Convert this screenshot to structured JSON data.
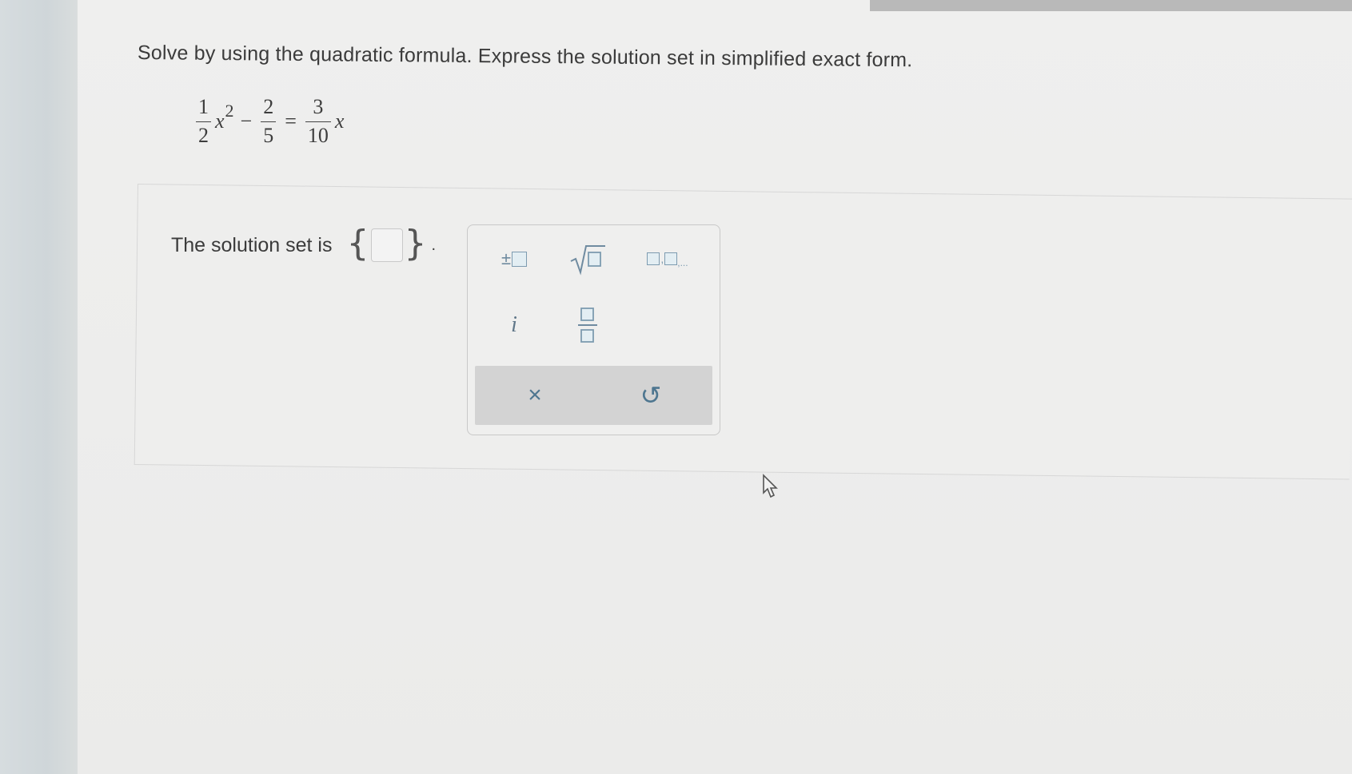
{
  "question": {
    "text": "Solve by using the quadratic formula. Express the solution set in simplified exact form."
  },
  "equation": {
    "term1_num": "1",
    "term1_den": "2",
    "var1": "x",
    "exp": "2",
    "minus": "−",
    "term2_num": "2",
    "term2_den": "5",
    "equals": "=",
    "term3_num": "3",
    "term3_den": "10",
    "var2": "x"
  },
  "answer": {
    "label": "The solution set is",
    "brace_open": "{",
    "brace_close": "}",
    "period": ".",
    "input_value": ""
  },
  "palette": {
    "plus_minus_symbol": "±",
    "list_ellipsis": ",...",
    "imaginary_unit": "i",
    "clear_symbol": "×",
    "undo_symbol": "↺"
  },
  "colors": {
    "accent": "#4e7690",
    "template_box": "#7d9bb0"
  }
}
